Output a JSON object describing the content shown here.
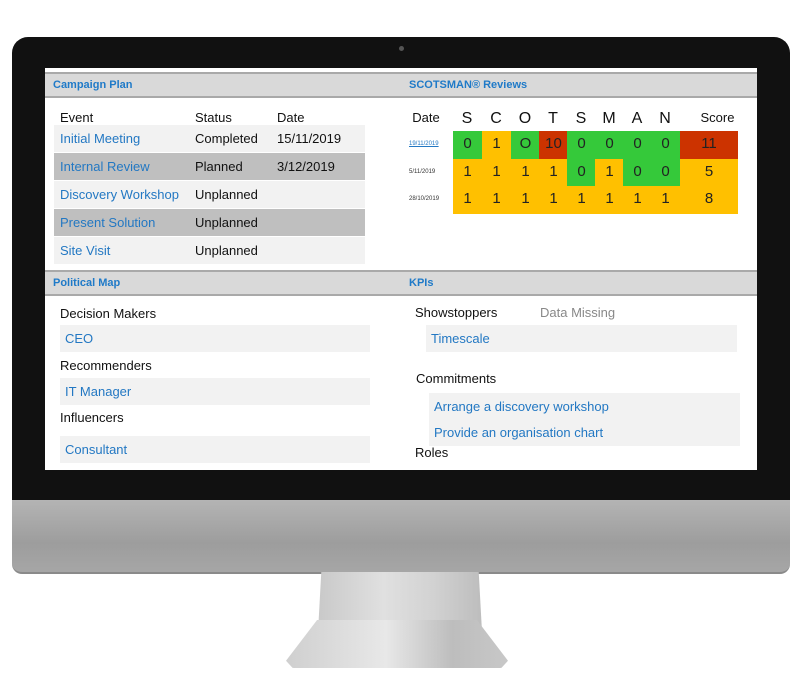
{
  "campaign_plan": {
    "title": "Campaign Plan",
    "headers": {
      "event": "Event",
      "status": "Status",
      "date": "Date"
    },
    "rows": [
      {
        "event": "Initial Meeting",
        "status": "Completed",
        "date": "15/11/2019"
      },
      {
        "event": "Internal Review",
        "status": "Planned",
        "date": "3/12/2019"
      },
      {
        "event": "Discovery Workshop",
        "status": "Unplanned",
        "date": ""
      },
      {
        "event": "Present Solution",
        "status": "Unplanned",
        "date": ""
      },
      {
        "event": "Site Visit",
        "status": "Unplanned",
        "date": ""
      }
    ]
  },
  "reviews": {
    "title": "SCOTSMAN® Reviews",
    "headers": [
      "Date",
      "S",
      "C",
      "O",
      "T",
      "S",
      "M",
      "A",
      "N",
      "Score"
    ],
    "rows": [
      {
        "date": "19/11/2019",
        "values": [
          "0",
          "1",
          "O",
          "10",
          "0",
          "0",
          "0",
          "0"
        ],
        "colors": [
          "g",
          "y",
          "g",
          "r",
          "g",
          "g",
          "g",
          "g"
        ],
        "score": "11",
        "score_color": "r"
      },
      {
        "date": "5/11/2019",
        "values": [
          "1",
          "1",
          "1",
          "1",
          "0",
          "1",
          "0",
          "0"
        ],
        "colors": [
          "y",
          "y",
          "y",
          "y",
          "g",
          "y",
          "g",
          "g"
        ],
        "score": "5",
        "score_color": "y"
      },
      {
        "date": "28/10/2019",
        "values": [
          "1",
          "1",
          "1",
          "1",
          "1",
          "1",
          "1",
          "1"
        ],
        "colors": [
          "y",
          "y",
          "y",
          "y",
          "y",
          "y",
          "y",
          "y"
        ],
        "score": "8",
        "score_color": "y"
      }
    ],
    "colors": {
      "g": "#35c93a",
      "y": "#ffc000",
      "r": "#cc3300"
    }
  },
  "political_map": {
    "title": "Political Map",
    "groups": [
      {
        "label": "Decision Makers",
        "items": [
          "CEO"
        ]
      },
      {
        "label": "Recommenders",
        "items": [
          "IT Manager"
        ]
      },
      {
        "label": "Influencers",
        "items": [
          "Consultant"
        ]
      }
    ]
  },
  "kpis": {
    "title": "KPIs",
    "showstoppers_label": "Showstoppers",
    "data_missing": "Data Missing",
    "showstoppers": [
      "Timescale"
    ],
    "commitments_label": "Commitments",
    "commitments": [
      "Arrange a discovery workshop",
      "Provide an organisation chart"
    ],
    "roles_label": "Roles"
  }
}
